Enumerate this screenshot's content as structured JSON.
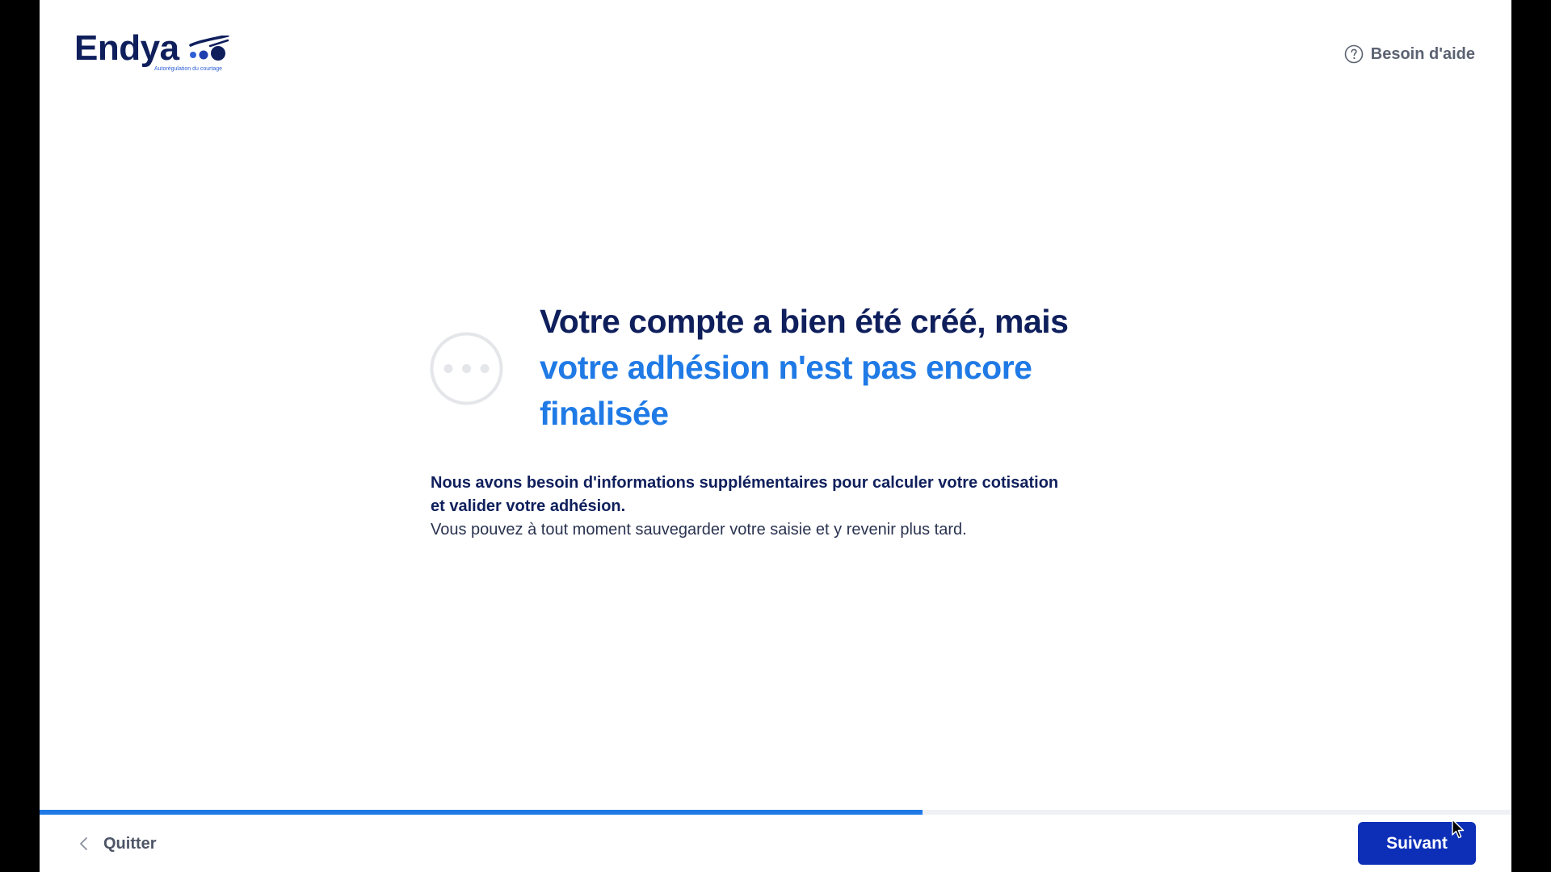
{
  "header": {
    "logo_text": "Endya",
    "logo_tagline": "Autorégulation du courtage",
    "help_label": "Besoin d'aide",
    "help_icon": "question-circle-icon"
  },
  "main": {
    "status_icon": "ellipsis-circle-icon",
    "title_line1": "Votre compte a bien été créé, mais",
    "title_line2": "votre adhésion n'est pas encore",
    "title_line3": "finalisée",
    "desc_bold": "Nous avons besoin d'informations supplémentaires pour calculer votre cotisation\net valider votre adhésion.",
    "desc_regular": "Vous pouvez à tout moment sauvegarder votre saisie et y revenir plus tard."
  },
  "footer": {
    "progress_fraction": 0.6,
    "quit_label": "Quitter",
    "quit_icon": "chevron-left-icon",
    "next_label": "Suivant"
  },
  "colors": {
    "brand_dark": "#0f1f5c",
    "accent_blue": "#1f7ae6",
    "button_blue": "#0d2fb8"
  }
}
